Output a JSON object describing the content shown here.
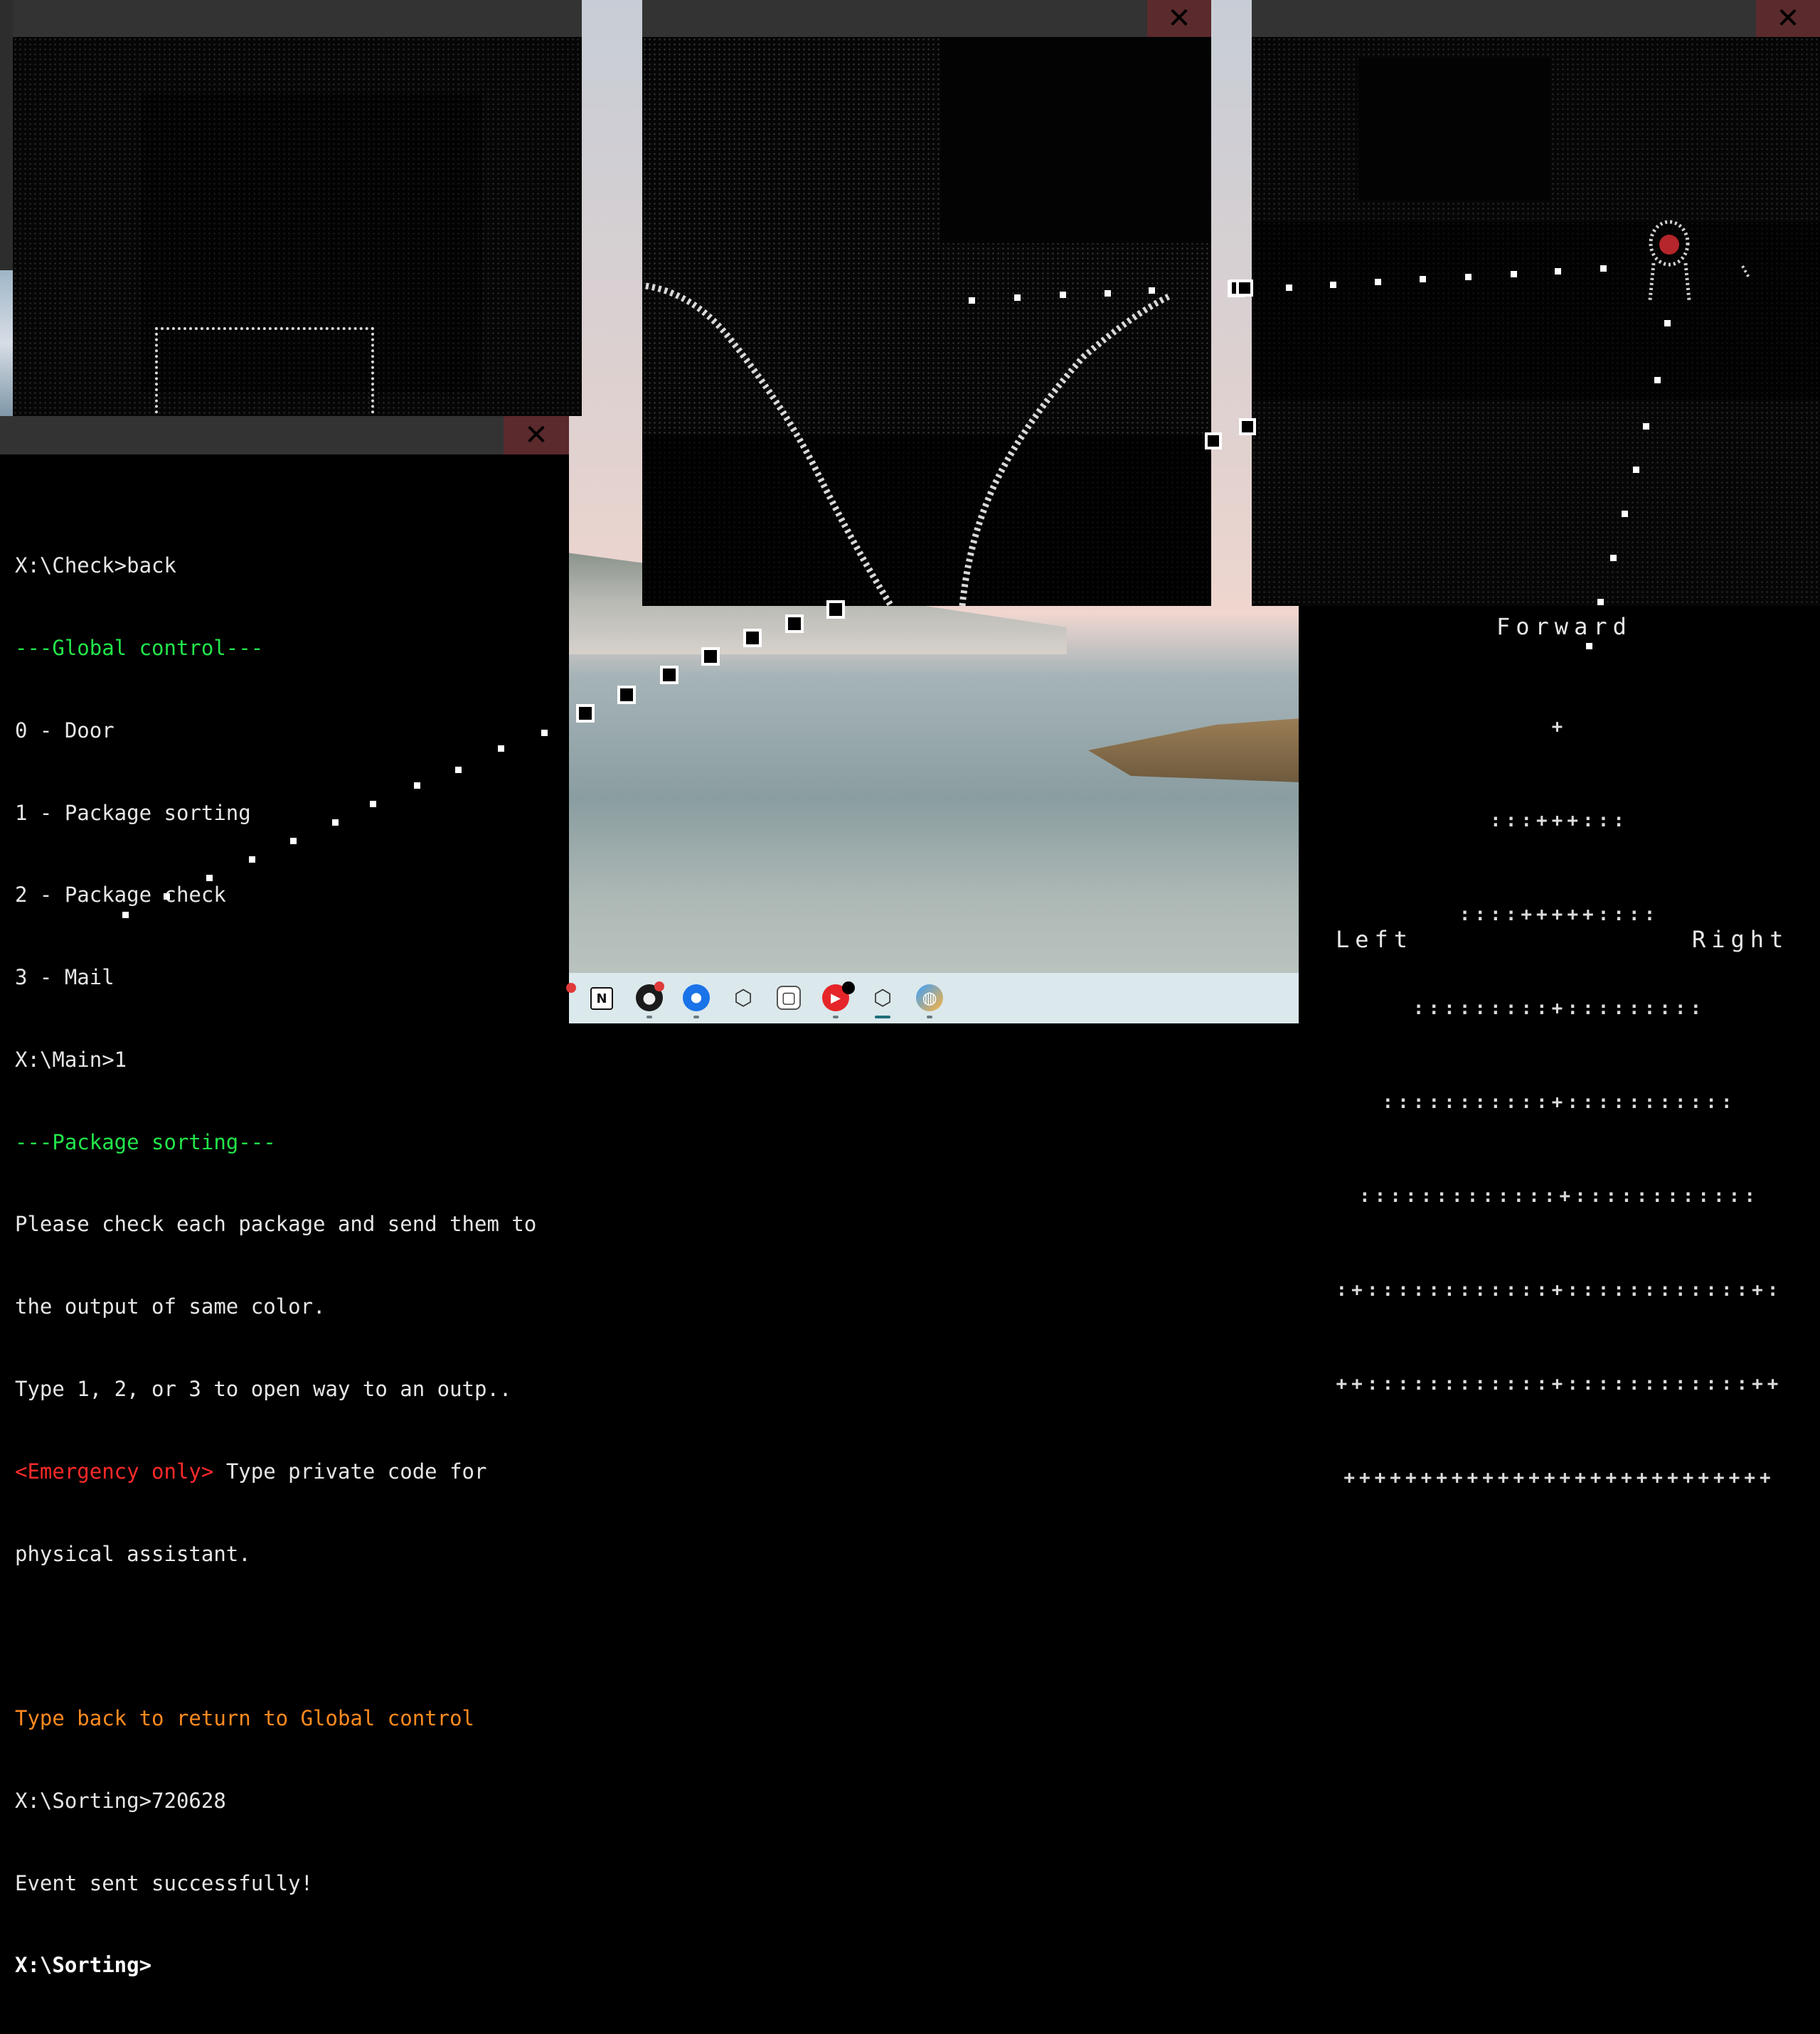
{
  "terminal": {
    "lines": [
      {
        "text": "X:\\Check>back",
        "style": "normal"
      },
      {
        "text": "---Global control---",
        "style": "green"
      },
      {
        "text": "0 - Door",
        "style": "normal"
      },
      {
        "text": "1 - Package sorting",
        "style": "normal"
      },
      {
        "text": "2 - Package check",
        "style": "normal"
      },
      {
        "text": "3 - Mail",
        "style": "normal"
      },
      {
        "text": "X:\\Main>1",
        "style": "normal"
      },
      {
        "text": "---Package sorting---",
        "style": "green"
      },
      {
        "text": "Please check each package and send them to",
        "style": "normal"
      },
      {
        "text": "the output of same color.",
        "style": "normal"
      },
      {
        "text": "Type 1, 2, or 3 to open way to an outp..",
        "style": "normal"
      },
      {
        "text_emergency": "<Emergency only>",
        "text": " Type private code for",
        "style": "emergency"
      },
      {
        "text": "physical assistant.",
        "style": "normal"
      },
      {
        "text": "",
        "style": "normal"
      },
      {
        "text": "Type back to return to Global control",
        "style": "orange"
      },
      {
        "text": "X:\\Sorting>720628",
        "style": "normal"
      },
      {
        "text": "Event sent successfully!",
        "style": "normal"
      },
      {
        "text": "X:\\Sorting>",
        "style": "bold"
      }
    ]
  },
  "windows": {
    "close_glyph": "✕"
  },
  "controls": {
    "forward": "Forward",
    "left": "Left",
    "right": "Right",
    "grid_rows": [
      "+",
      ":::+++:::",
      "::::+++++::::",
      ":::::::::+:::::::::",
      ":::::::::::+:::::::::::",
      ":::::::::::::+::::::::::::",
      ":+::::::::::::+::::::::::::+:",
      "++::::::::::::+::::::::::::++",
      "++++++++++++++++++++++++++++"
    ]
  },
  "taskbar": {
    "icons": [
      {
        "name": "notion-icon",
        "glyph": "N"
      },
      {
        "name": "recorder-icon",
        "glyph": "●"
      },
      {
        "name": "maps-icon",
        "glyph": "⬤"
      },
      {
        "name": "unity-icon",
        "glyph": "⬡"
      },
      {
        "name": "twitch-icon",
        "glyph": "▢"
      },
      {
        "name": "youtube-music-icon",
        "glyph": "▶"
      },
      {
        "name": "unity-hub-icon",
        "glyph": "⬡"
      },
      {
        "name": "globe-icon",
        "glyph": "◍"
      }
    ]
  },
  "colors": {
    "terminal_green": "#22e64a",
    "terminal_red": "#ff2a2a",
    "terminal_orange": "#ff8a1f",
    "titlebar": "#333333",
    "close_button": "#5b2a2d"
  }
}
